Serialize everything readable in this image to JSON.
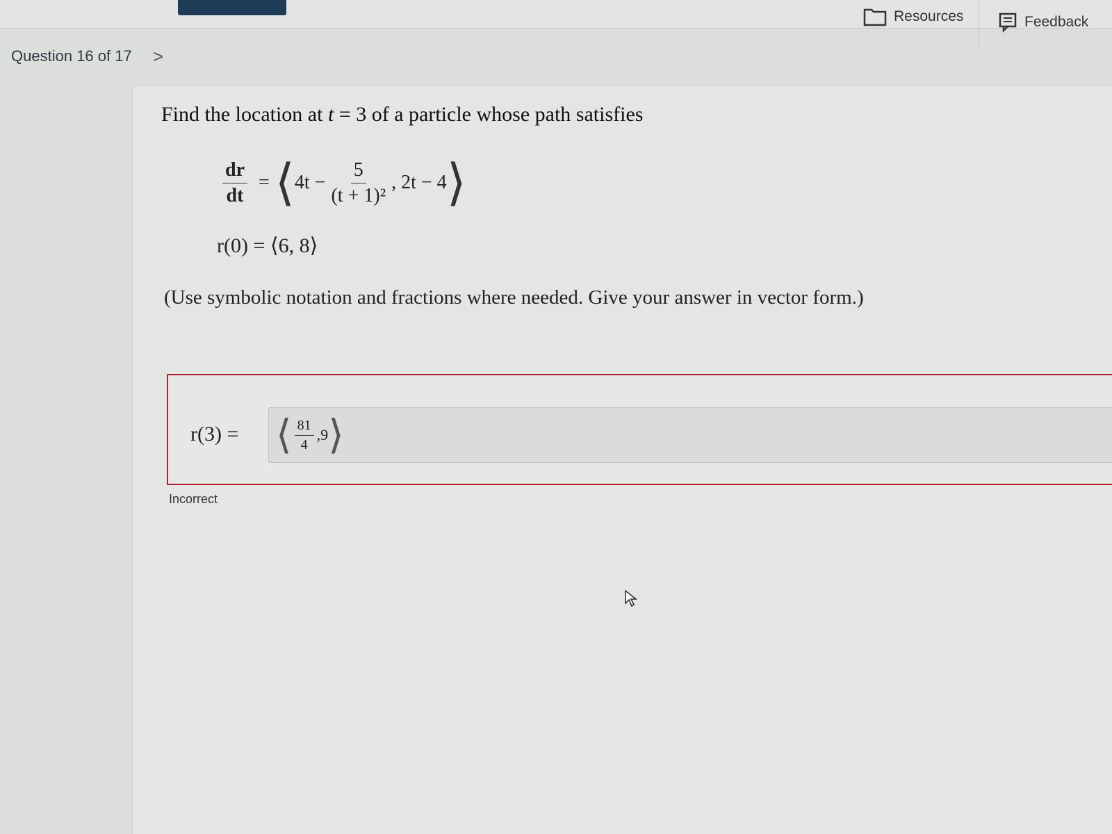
{
  "header": {
    "resources_label": "Resources",
    "feedback_label": "Feedback"
  },
  "nav": {
    "question_counter": "Question 16 of 17",
    "next_icon": "chevron-right-icon"
  },
  "question": {
    "prompt_prefix": "Find the location at ",
    "prompt_var": "t",
    "prompt_suffix": " = 3 of a particle whose path satisfies",
    "lhs_num": "dr",
    "lhs_den": "dt",
    "term1": "4t −",
    "frac_num": "5",
    "frac_den": "(t + 1)²",
    "term2": ", 2t − 4",
    "initial_condition": "r(0) = ⟨6, 8⟩",
    "instructions": "(Use symbolic notation and fractions where needed. Give your answer in vector form.)"
  },
  "answer": {
    "label": "r(3) =",
    "input_num": "81",
    "input_den": "4",
    "input_rest": ",9",
    "status": "Incorrect",
    "status_color": "#a8242c"
  }
}
